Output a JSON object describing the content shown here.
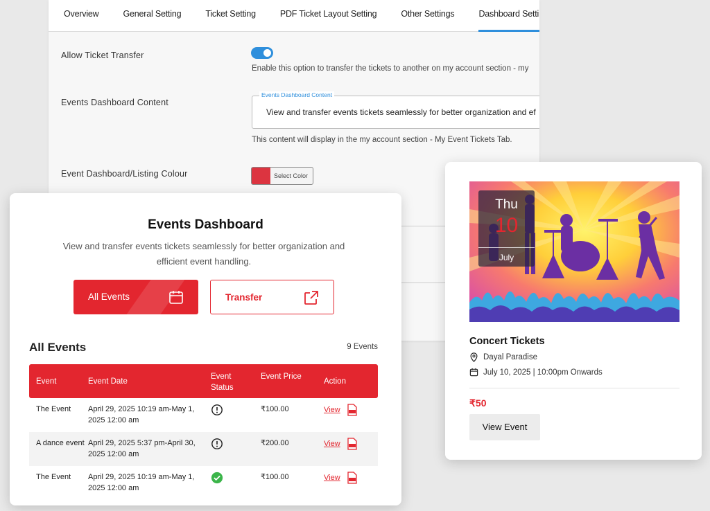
{
  "settings": {
    "tabs": [
      "Overview",
      "General Setting",
      "Ticket Setting",
      "PDF Ticket Layout Setting",
      "Other Settings",
      "Dashboard Settings"
    ],
    "active_tab": "Dashboard Settings",
    "allow_transfer": {
      "label": "Allow Ticket Transfer",
      "enabled": true,
      "help": "Enable this option to transfer the tickets to another on my account section - my"
    },
    "dashboard_content": {
      "label": "Events Dashboard Content",
      "legend": "Events Dashboard Content",
      "value": "View and transfer events tickets seamlessly for better organization and ef",
      "help": "This content will display in the my account section - My Event Tickets Tab."
    },
    "listing_colour": {
      "label": "Event Dashboard/Listing Colour",
      "button": "Select Color",
      "color": "#dc3440"
    }
  },
  "dashboard": {
    "title": "Events Dashboard",
    "description": "View and transfer events tickets seamlessly for better organization and efficient event handling.",
    "buttons": {
      "all_events": "All Events",
      "transfer": "Transfer"
    },
    "section_title": "All Events",
    "count": "9 Events",
    "columns": [
      "Event",
      "Event Date",
      "Event Status",
      "Event Price",
      "Action"
    ],
    "rows": [
      {
        "event": "The Event",
        "date": "April 29, 2025 10:19 am-May 1, 2025 12:00 am",
        "status": "info",
        "price": "₹100.00",
        "action": "View"
      },
      {
        "event": "A dance event",
        "date": "April 29, 2025 5:37 pm-April 30, 2025 12:00 am",
        "status": "info",
        "price": "₹200.00",
        "action": "View"
      },
      {
        "event": "The Event",
        "date": "April 29, 2025 10:19 am-May 1, 2025 12:00 am",
        "status": "check",
        "price": "₹100.00",
        "action": "View"
      }
    ],
    "accent": "#e3262f"
  },
  "card": {
    "dow": "Thu",
    "day": "10",
    "month": "July",
    "title": "Concert Tickets",
    "location": "Dayal Paradise",
    "datetime": "July 10, 2025 | 10:00pm Onwards",
    "price": "₹50",
    "button": "View Event"
  }
}
